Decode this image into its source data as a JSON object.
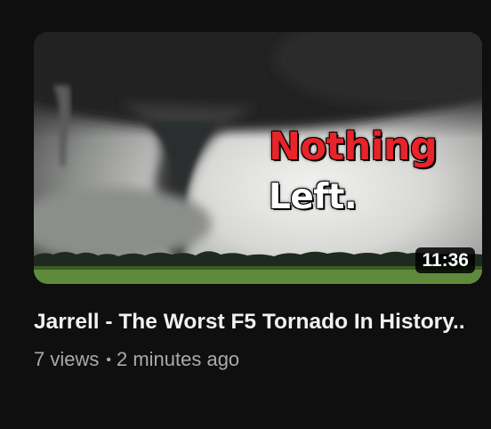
{
  "video": {
    "thumbnail_text_line1": "Nothing",
    "thumbnail_text_line2": "Left.",
    "duration": "11:36",
    "title": "Jarrell - The Worst F5 Tornado In History..",
    "views": "7 views",
    "separator": "•",
    "uploaded": "2 minutes ago"
  },
  "colors": {
    "background": "#0f0f0f",
    "title_text": "#f1f1f1",
    "meta_text": "#aaaaaa",
    "overlay_red": "#e8232a",
    "overlay_white": "#ffffff"
  }
}
